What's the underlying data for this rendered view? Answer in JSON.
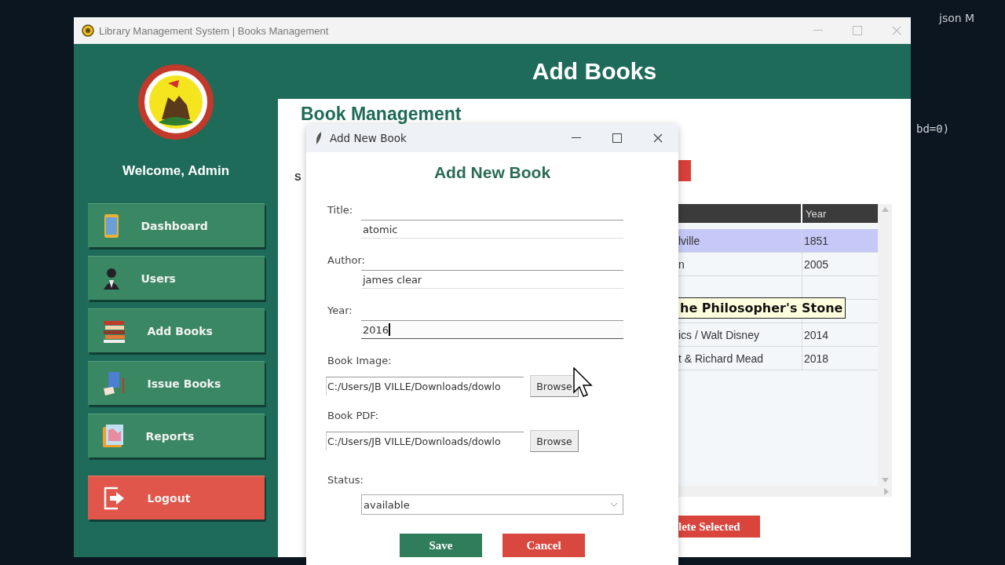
{
  "background": {
    "editor_tab": "json M",
    "code": "bd=0)"
  },
  "window": {
    "title": "Library Management System | Books Management",
    "header": "Add Books"
  },
  "sidebar": {
    "welcome": "Welcome, Admin",
    "items": [
      {
        "label": "Dashboard",
        "kind": "tablet"
      },
      {
        "label": "Users",
        "kind": "person"
      },
      {
        "label": "Add Books",
        "kind": "books"
      },
      {
        "label": "Issue Books",
        "kind": "book"
      },
      {
        "label": "Reports",
        "kind": "chart"
      }
    ],
    "logout": "Logout"
  },
  "panel": {
    "heading": "Book Management",
    "search_label": "S",
    "table": {
      "year_header": "Year",
      "rows": [
        {
          "column_1": "lville",
          "year": "1851",
          "selected": true
        },
        {
          "column_1": "n",
          "year": "2005",
          "selected": false
        },
        {
          "selected": false
        },
        {
          "selected": false
        },
        {
          "column_1": "ics / Walt Disney",
          "year": "2014",
          "selected": false
        },
        {
          "column_1": "t & Richard Mead",
          "year": "2018",
          "selected": false
        }
      ]
    },
    "delete_button": "lete Selected"
  },
  "tooltip": "he Philosopher's Stone",
  "dialog": {
    "title": "Add New Book",
    "heading": "Add New Book",
    "fields": [
      {
        "label": "Title:",
        "value": "atomic",
        "focused": false
      },
      {
        "label": "Author:",
        "value": "james clear",
        "focused": false
      },
      {
        "label": "Year:",
        "value": "2016",
        "focused": true
      }
    ],
    "files": [
      {
        "label": "Book Image:",
        "value": "C:/Users/JB VILLE/Downloads/dowlo",
        "button": "Browse"
      },
      {
        "label": "Book PDF:",
        "value": "C:/Users/JB VILLE/Downloads/dowlo",
        "button": "Browse"
      }
    ],
    "status": {
      "label": "Status:",
      "value": "available"
    },
    "buttons": [
      {
        "label": "Save",
        "kind": "primary"
      },
      {
        "label": "Cancel",
        "kind": "danger"
      }
    ]
  }
}
